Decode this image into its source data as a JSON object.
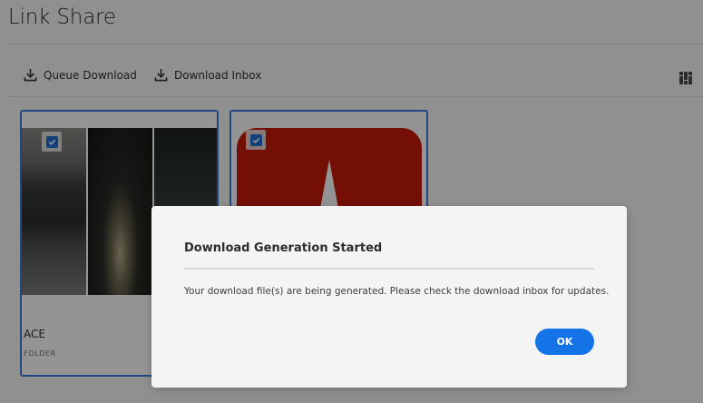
{
  "page": {
    "title": "Link Share"
  },
  "toolbar": {
    "queue_download_label": "Queue Download",
    "download_inbox_label": "Download Inbox",
    "view_toggle_icon": "grid-view-icon"
  },
  "cards": [
    {
      "name": "ACE",
      "type": "FOLDER",
      "selected": true,
      "thumbnail": "photo-collage"
    },
    {
      "name": "",
      "type": "",
      "selected": true,
      "thumbnail": "adobe-logo"
    }
  ],
  "dialog": {
    "title": "Download Generation Started",
    "message": "Your download file(s) are being generated. Please check the download inbox for updates.",
    "ok_label": "OK"
  },
  "colors": {
    "accent": "#1473e6",
    "card_border": "#3a7ad9",
    "checkbox": "#1f6fd4",
    "adobe_red": "#c91b0a"
  }
}
